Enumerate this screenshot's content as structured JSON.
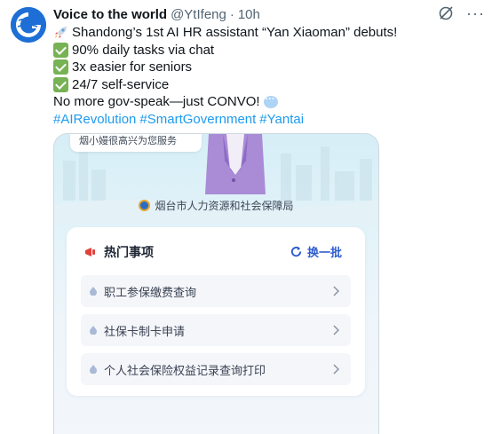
{
  "post": {
    "author_name": "Voice to the world",
    "handle": "@YtIfeng",
    "separator": "·",
    "time": "10h",
    "more_label": "···",
    "lines": [
      {
        "emoji": "rocket",
        "text": "Shandong’s 1st AI HR assistant “Yan Xiaoman” debuts!"
      },
      {
        "emoji": "check",
        "text": "90% daily tasks via chat"
      },
      {
        "emoji": "check",
        "text": "3x easier for seniors"
      },
      {
        "emoji": "check",
        "text": "24/7 self-service"
      },
      {
        "emoji": "speech-bubble",
        "text": "No more gov-speak—just CONVO!"
      }
    ],
    "hashtags": [
      "#AIRevolution",
      "#SmartGovernment",
      "#Yantai"
    ]
  },
  "media": {
    "greeting": "烟小嫚很高兴为您服务",
    "bureau": "烟台市人力资源和社会保障局",
    "hot_title": "热门事项",
    "refresh_label": "换一批",
    "items": [
      {
        "label": "职工参保缴费查询"
      },
      {
        "label": "社保卡制卡申请"
      },
      {
        "label": "个人社会保险权益记录查询打印"
      }
    ]
  },
  "colors": {
    "link": "#1d9bf0",
    "accent_blue": "#2d5bd0",
    "check_green": "#77b255",
    "flag_red": "#e0423b"
  }
}
